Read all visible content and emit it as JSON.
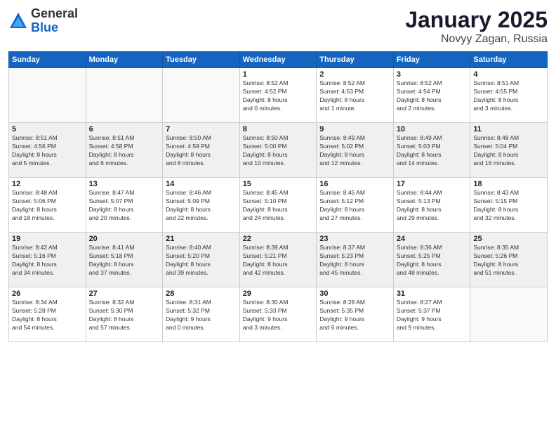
{
  "logo": {
    "general": "General",
    "blue": "Blue"
  },
  "title": {
    "month": "January 2025",
    "location": "Novyy Zagan, Russia"
  },
  "headers": [
    "Sunday",
    "Monday",
    "Tuesday",
    "Wednesday",
    "Thursday",
    "Friday",
    "Saturday"
  ],
  "weeks": [
    [
      {
        "day": "",
        "info": ""
      },
      {
        "day": "",
        "info": ""
      },
      {
        "day": "",
        "info": ""
      },
      {
        "day": "1",
        "info": "Sunrise: 8:52 AM\nSunset: 4:52 PM\nDaylight: 8 hours\nand 0 minutes."
      },
      {
        "day": "2",
        "info": "Sunrise: 8:52 AM\nSunset: 4:53 PM\nDaylight: 8 hours\nand 1 minute."
      },
      {
        "day": "3",
        "info": "Sunrise: 8:52 AM\nSunset: 4:54 PM\nDaylight: 8 hours\nand 2 minutes."
      },
      {
        "day": "4",
        "info": "Sunrise: 8:51 AM\nSunset: 4:55 PM\nDaylight: 8 hours\nand 3 minutes."
      }
    ],
    [
      {
        "day": "5",
        "info": "Sunrise: 8:51 AM\nSunset: 4:56 PM\nDaylight: 8 hours\nand 5 minutes."
      },
      {
        "day": "6",
        "info": "Sunrise: 8:51 AM\nSunset: 4:58 PM\nDaylight: 8 hours\nand 6 minutes."
      },
      {
        "day": "7",
        "info": "Sunrise: 8:50 AM\nSunset: 4:59 PM\nDaylight: 8 hours\nand 8 minutes."
      },
      {
        "day": "8",
        "info": "Sunrise: 8:50 AM\nSunset: 5:00 PM\nDaylight: 8 hours\nand 10 minutes."
      },
      {
        "day": "9",
        "info": "Sunrise: 8:49 AM\nSunset: 5:02 PM\nDaylight: 8 hours\nand 12 minutes."
      },
      {
        "day": "10",
        "info": "Sunrise: 8:49 AM\nSunset: 5:03 PM\nDaylight: 8 hours\nand 14 minutes."
      },
      {
        "day": "11",
        "info": "Sunrise: 8:48 AM\nSunset: 5:04 PM\nDaylight: 8 hours\nand 16 minutes."
      }
    ],
    [
      {
        "day": "12",
        "info": "Sunrise: 8:48 AM\nSunset: 5:06 PM\nDaylight: 8 hours\nand 18 minutes."
      },
      {
        "day": "13",
        "info": "Sunrise: 8:47 AM\nSunset: 5:07 PM\nDaylight: 8 hours\nand 20 minutes."
      },
      {
        "day": "14",
        "info": "Sunrise: 8:46 AM\nSunset: 5:09 PM\nDaylight: 8 hours\nand 22 minutes."
      },
      {
        "day": "15",
        "info": "Sunrise: 8:45 AM\nSunset: 5:10 PM\nDaylight: 8 hours\nand 24 minutes."
      },
      {
        "day": "16",
        "info": "Sunrise: 8:45 AM\nSunset: 5:12 PM\nDaylight: 8 hours\nand 27 minutes."
      },
      {
        "day": "17",
        "info": "Sunrise: 8:44 AM\nSunset: 5:13 PM\nDaylight: 8 hours\nand 29 minutes."
      },
      {
        "day": "18",
        "info": "Sunrise: 8:43 AM\nSunset: 5:15 PM\nDaylight: 8 hours\nand 32 minutes."
      }
    ],
    [
      {
        "day": "19",
        "info": "Sunrise: 8:42 AM\nSunset: 5:16 PM\nDaylight: 8 hours\nand 34 minutes."
      },
      {
        "day": "20",
        "info": "Sunrise: 8:41 AM\nSunset: 5:18 PM\nDaylight: 8 hours\nand 37 minutes."
      },
      {
        "day": "21",
        "info": "Sunrise: 8:40 AM\nSunset: 5:20 PM\nDaylight: 8 hours\nand 39 minutes."
      },
      {
        "day": "22",
        "info": "Sunrise: 8:39 AM\nSunset: 5:21 PM\nDaylight: 8 hours\nand 42 minutes."
      },
      {
        "day": "23",
        "info": "Sunrise: 8:37 AM\nSunset: 5:23 PM\nDaylight: 8 hours\nand 45 minutes."
      },
      {
        "day": "24",
        "info": "Sunrise: 8:36 AM\nSunset: 5:25 PM\nDaylight: 8 hours\nand 48 minutes."
      },
      {
        "day": "25",
        "info": "Sunrise: 8:35 AM\nSunset: 5:26 PM\nDaylight: 8 hours\nand 51 minutes."
      }
    ],
    [
      {
        "day": "26",
        "info": "Sunrise: 8:34 AM\nSunset: 5:28 PM\nDaylight: 8 hours\nand 54 minutes."
      },
      {
        "day": "27",
        "info": "Sunrise: 8:32 AM\nSunset: 5:30 PM\nDaylight: 8 hours\nand 57 minutes."
      },
      {
        "day": "28",
        "info": "Sunrise: 8:31 AM\nSunset: 5:32 PM\nDaylight: 9 hours\nand 0 minutes."
      },
      {
        "day": "29",
        "info": "Sunrise: 8:30 AM\nSunset: 5:33 PM\nDaylight: 9 hours\nand 3 minutes."
      },
      {
        "day": "30",
        "info": "Sunrise: 8:28 AM\nSunset: 5:35 PM\nDaylight: 9 hours\nand 6 minutes."
      },
      {
        "day": "31",
        "info": "Sunrise: 8:27 AM\nSunset: 5:37 PM\nDaylight: 9 hours\nand 9 minutes."
      },
      {
        "day": "",
        "info": ""
      }
    ]
  ]
}
